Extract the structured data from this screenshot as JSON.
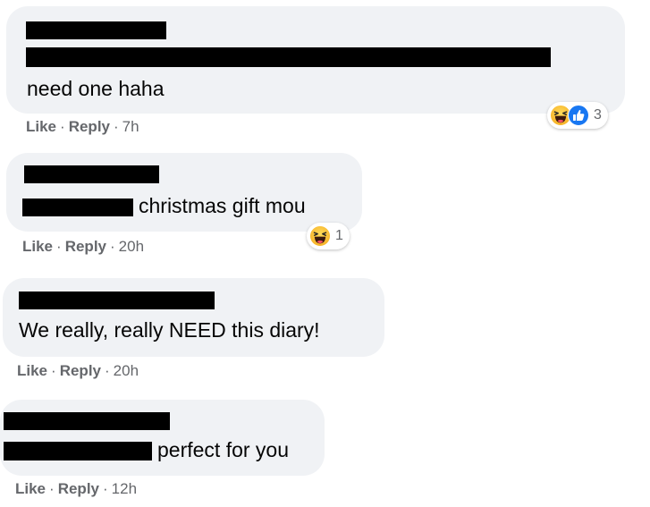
{
  "comments": [
    {
      "text": "need one haha",
      "actions": {
        "like": "Like",
        "reply": "Reply",
        "time": "7h"
      },
      "reactions": {
        "emojis": [
          "haha",
          "like"
        ],
        "count": "3"
      }
    },
    {
      "text": "christmas gift mou",
      "actions": {
        "like": "Like",
        "reply": "Reply",
        "time": "20h"
      },
      "reactions": {
        "emojis": [
          "haha"
        ],
        "count": "1"
      }
    },
    {
      "text": "We really, really NEED this diary!",
      "actions": {
        "like": "Like",
        "reply": "Reply",
        "time": "20h"
      }
    },
    {
      "text": "perfect for you",
      "actions": {
        "like": "Like",
        "reply": "Reply",
        "time": "12h"
      }
    }
  ],
  "separator": "·",
  "colors": {
    "bubble": "#f0f2f5",
    "meta_text": "#65676b",
    "like_blue": "#1877f2",
    "haha_yellow": "#f7b125"
  }
}
